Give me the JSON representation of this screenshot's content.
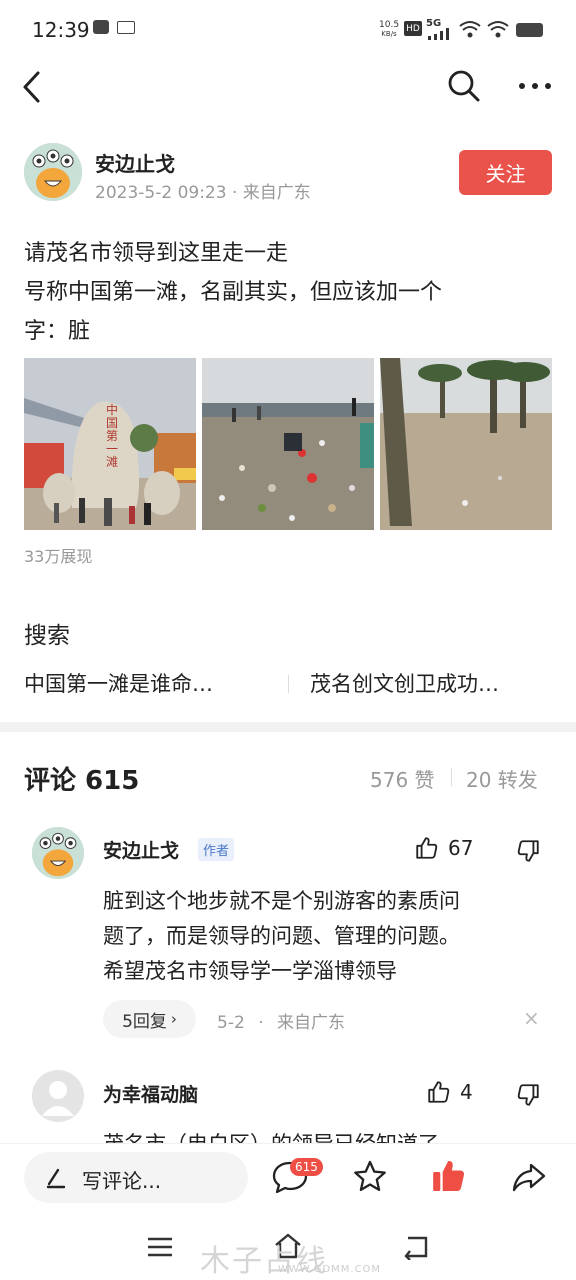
{
  "status_bar": {
    "time": "12:39",
    "net_speed_value": "10.5",
    "net_speed_unit": "KB/s",
    "hd_label": "HD",
    "network": "5G",
    "icons": [
      "mail-icon",
      "toutiao-icon",
      "signal-icon",
      "wifi-icon",
      "battery-icon"
    ]
  },
  "nav": {
    "icons": [
      "back-icon",
      "search-icon",
      "more-icon"
    ]
  },
  "post": {
    "author": "安边止戈",
    "date": "2023-5-2 09:23",
    "separator": "·",
    "location": "来自广东",
    "follow_label": "关注",
    "text_lines": [
      "请茂名市领导到这里走一走",
      "号称中国第一滩，名副其实，但应该加一个",
      "字：脏"
    ],
    "views": "33万展现",
    "monument_text": "中国第一滩"
  },
  "search": {
    "title": "搜索",
    "items": [
      "中国第一滩是谁命…",
      "茂名创文创卫成功…"
    ]
  },
  "comments": {
    "title": "评论 615",
    "likes": "576 赞",
    "reposts": "20 转发",
    "items": [
      {
        "name": "安边止戈",
        "tag": "作者",
        "like_count": "67",
        "text_lines": [
          "脏到这个地步就不是个别游客的素质问",
          "题了，而是领导的问题、管理的问题。",
          "希望茂名市领导学一学淄博领导"
        ],
        "replies": "5回复",
        "date": "5-2",
        "dot": "·",
        "location": "来自广东",
        "close": "×"
      },
      {
        "name": "为幸福动脑",
        "like_count": "4",
        "text_partial": "茂名市（电白区）的领导已经知道了"
      }
    ]
  },
  "bottom_bar": {
    "placeholder": "写评论...",
    "comment_badge": "615",
    "icons": [
      "pen-icon",
      "comment-icon",
      "star-icon",
      "thumbs-up-icon",
      "share-icon"
    ]
  },
  "watermark": {
    "text": "木子占线",
    "url": "WWW.GDMM.COM"
  },
  "colors": {
    "accent": "#e9534c",
    "like_active": "#ef4e45",
    "muted": "#999999",
    "tag_blue": "#4a78c9"
  }
}
